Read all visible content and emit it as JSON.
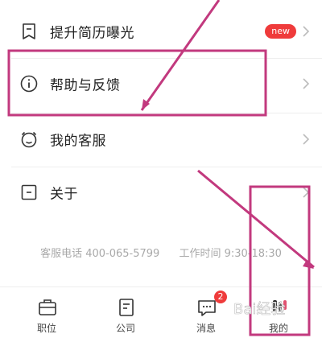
{
  "menu": {
    "items": [
      {
        "label": "提升简历曝光",
        "badge": "new",
        "icon": "bookmark-icon"
      },
      {
        "label": "帮助与反馈",
        "icon": "info-icon"
      },
      {
        "label": "我的客服",
        "icon": "alarm-clock-icon"
      },
      {
        "label": "关于",
        "icon": "square-minus-icon"
      }
    ]
  },
  "service": {
    "phone": "客服电话 400-065-5799",
    "hours": "工作时间 9:30-18:30"
  },
  "tabs": [
    {
      "label": "职位",
      "icon": "briefcase-icon"
    },
    {
      "label": "公司",
      "icon": "building-icon"
    },
    {
      "label": "消息",
      "icon": "message-icon",
      "badge": "2"
    },
    {
      "label": "我的",
      "icon": "profile-icon"
    }
  ],
  "watermark": "Bai经验",
  "colors": {
    "annotation": "#c2397e",
    "badge": "#ef3b3b"
  }
}
